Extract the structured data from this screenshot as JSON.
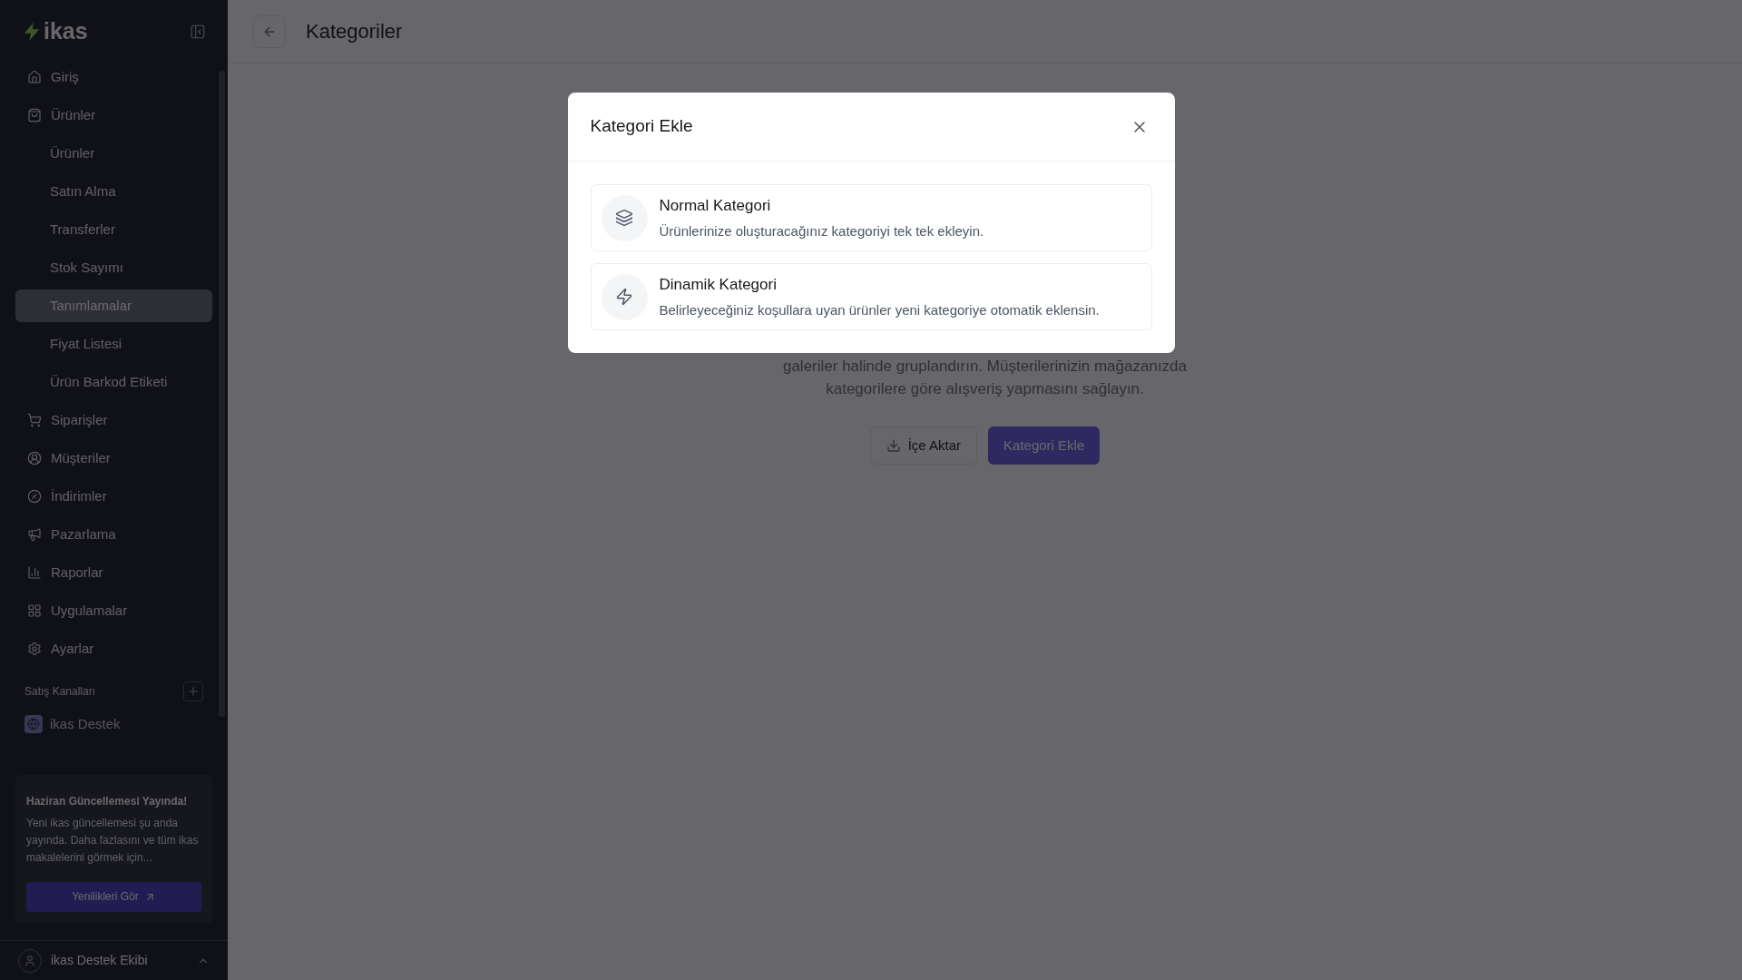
{
  "sidebar": {
    "logo": "ikas",
    "items": [
      {
        "label": "Giriş",
        "selected": false
      },
      {
        "label": "Ürünler",
        "selected": false,
        "children": [
          {
            "label": "Ürünler",
            "selected": false
          },
          {
            "label": "Satın Alma",
            "selected": false
          },
          {
            "label": "Transferler",
            "selected": false
          },
          {
            "label": "Stok Sayımı",
            "selected": false
          },
          {
            "label": "Tanımlamalar",
            "selected": true
          },
          {
            "label": "Fiyat Listesi",
            "selected": false
          },
          {
            "label": "Ürün Barkod Etiketi",
            "selected": false
          }
        ]
      },
      {
        "label": "Siparişler",
        "selected": false
      },
      {
        "label": "Müşteriler",
        "selected": false
      },
      {
        "label": "İndirimler",
        "selected": false
      },
      {
        "label": "Pazarlama",
        "selected": false
      },
      {
        "label": "Raporlar",
        "selected": false
      },
      {
        "label": "Uygulamalar",
        "selected": false
      },
      {
        "label": "Ayarlar",
        "selected": false
      }
    ],
    "channels_heading": "Satış Kanalları",
    "channels": [
      {
        "label": "ikas Destek"
      }
    ],
    "update_card": {
      "title": "Haziran Güncellemesi Yayında!",
      "text": "Yeni ikas güncellemesi şu anda yayında. Daha fazlasını ve tüm ikas makalelerini görmek için...",
      "button": "Yenilikleri Gör"
    },
    "user": {
      "name": "ikas Destek Ekibi"
    }
  },
  "header": {
    "title": "Kategoriler"
  },
  "empty_state": {
    "description_lines": [
      "galeriler halinde gruplandırın. Müşterilerinizin mağazanızda",
      "kategorilere göre alışveriş yapmasını sağlayın."
    ],
    "import_button": "İçe Aktar",
    "add_button": "Kategori Ekle"
  },
  "dialog": {
    "title": "Kategori Ekle",
    "options": [
      {
        "kind": "normal",
        "title": "Normal Kategori",
        "description": "Ürünlerinize oluşturacağınız kategoriyi tek tek ekleyin."
      },
      {
        "kind": "dynamic",
        "title": "Dinamik Kategori",
        "description": "Belirleyeceğiniz koşullara uyan ürünler yeni kategoriye otomatik eklensin."
      }
    ]
  }
}
